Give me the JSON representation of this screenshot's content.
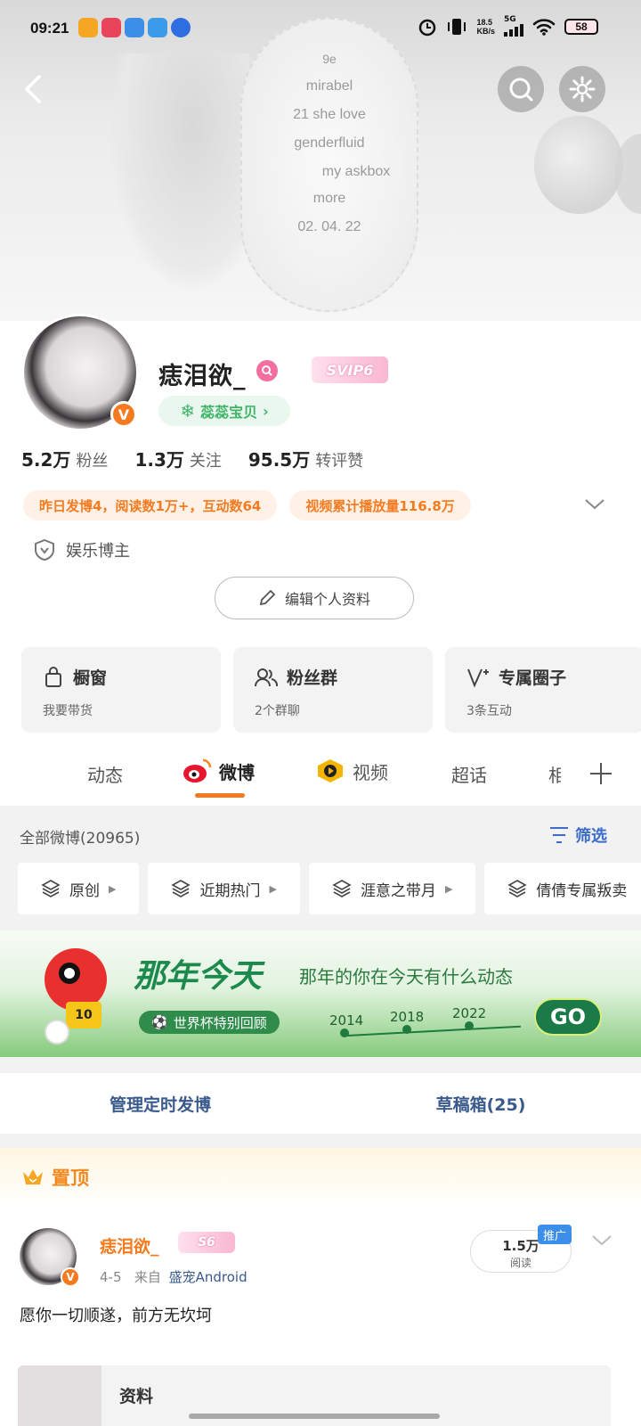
{
  "status_bar": {
    "time": "09:21",
    "network_speed": "18.5\nKB/s",
    "network": "5G",
    "battery": "58"
  },
  "cover": {
    "lines": [
      "9e",
      "mirabel",
      "21   she love",
      "genderfluid",
      "my askbox",
      "more",
      "02.  04.  22"
    ]
  },
  "profile": {
    "username": "痣泪欲_",
    "vip_badge": "SVIP6",
    "fan_tag": "蕊蕊宝贝",
    "verified": "V",
    "stats": [
      {
        "value": "5.2万",
        "label": "粉丝"
      },
      {
        "value": "1.3万",
        "label": "关注"
      },
      {
        "value": "95.5万",
        "label": "转评赞"
      }
    ],
    "pills": [
      "昨日发博4，阅读数1万+，互动数64",
      "视频累计播放量116.8万"
    ],
    "role": "娱乐博主",
    "edit_button": "编辑个人资料"
  },
  "cards": [
    {
      "title": "橱窗",
      "sub": "我要带货",
      "icon": "bag-icon"
    },
    {
      "title": "粉丝群",
      "sub": "2个群聊",
      "icon": "group-icon"
    },
    {
      "title": "专属圈子",
      "sub": "3条互动",
      "icon": "circle-v-icon"
    }
  ],
  "tabs": [
    "动态",
    "微博",
    "视频",
    "超话",
    "相"
  ],
  "feed": {
    "all_title": "全部微博(20965)",
    "filter_label": "筛选",
    "chips": [
      "原创",
      "近期热门",
      "涯意之带月",
      "倩倩专属叛卖"
    ]
  },
  "banner": {
    "headline": "那年今天",
    "slogan": "那年的你在今天有什么动态",
    "cup_label": "世界杯特别回顾",
    "years": [
      "2014",
      "2018",
      "2022"
    ],
    "go": "GO",
    "jersey_number": "10"
  },
  "actions": [
    "管理定时发博",
    "草稿箱(25)"
  ],
  "pinned_post": {
    "label": "置顶",
    "author": "痣泪欲_",
    "vip": "S6",
    "date": "4-5",
    "from_label": "来自",
    "source": "盛宠Android",
    "reads_value": "1.5万",
    "reads_label": "阅读",
    "promo": "推广",
    "text": "愿你一切顺遂，前方无坎坷",
    "attachment_title": "资料"
  },
  "colors": {
    "accent_orange": "#f5791f",
    "link_blue": "#3a5a8c",
    "vip_pink": "#f9b7d2",
    "fan_green": "#41b46a"
  }
}
